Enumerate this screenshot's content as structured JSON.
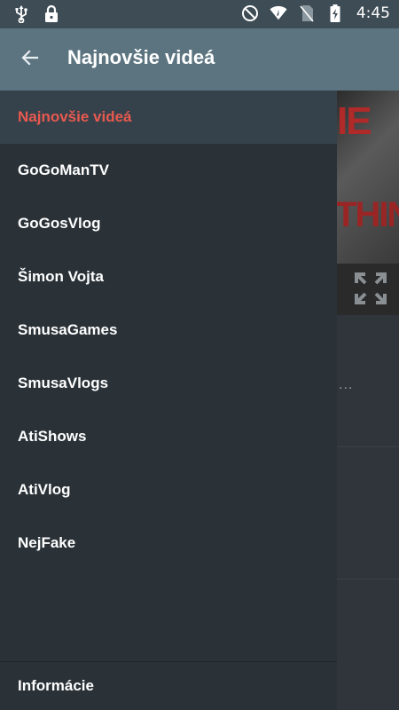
{
  "status_bar": {
    "time": "4:45",
    "left_icons": [
      "usb-icon",
      "lock-icon"
    ],
    "right_icons": [
      "do-not-disturb-icon",
      "wifi-icon",
      "no-sim-icon",
      "battery-charging-icon"
    ]
  },
  "toolbar": {
    "title": "Najnovšie videá",
    "back_icon": "arrow-back-icon"
  },
  "drawer": {
    "items": [
      {
        "label": "Najnovšie videá",
        "active": true
      },
      {
        "label": "GoGoManTV"
      },
      {
        "label": "GoGosVlog"
      },
      {
        "label": "Šimon Vojta"
      },
      {
        "label": "SmusaGames"
      },
      {
        "label": "SmusaVlogs"
      },
      {
        "label": "AtiShows"
      },
      {
        "label": "AtiVlog"
      },
      {
        "label": "NejFake"
      }
    ],
    "footer_label": "Informácie"
  },
  "background": {
    "text_top": "IE",
    "text_mid": "THIN",
    "more_dots": "..."
  },
  "colors": {
    "status_bar": "#3e4c55",
    "toolbar": "#5b7480",
    "drawer_bg": "#2a3238",
    "active_item_bg": "#36424b",
    "active_text": "#e8594f"
  }
}
